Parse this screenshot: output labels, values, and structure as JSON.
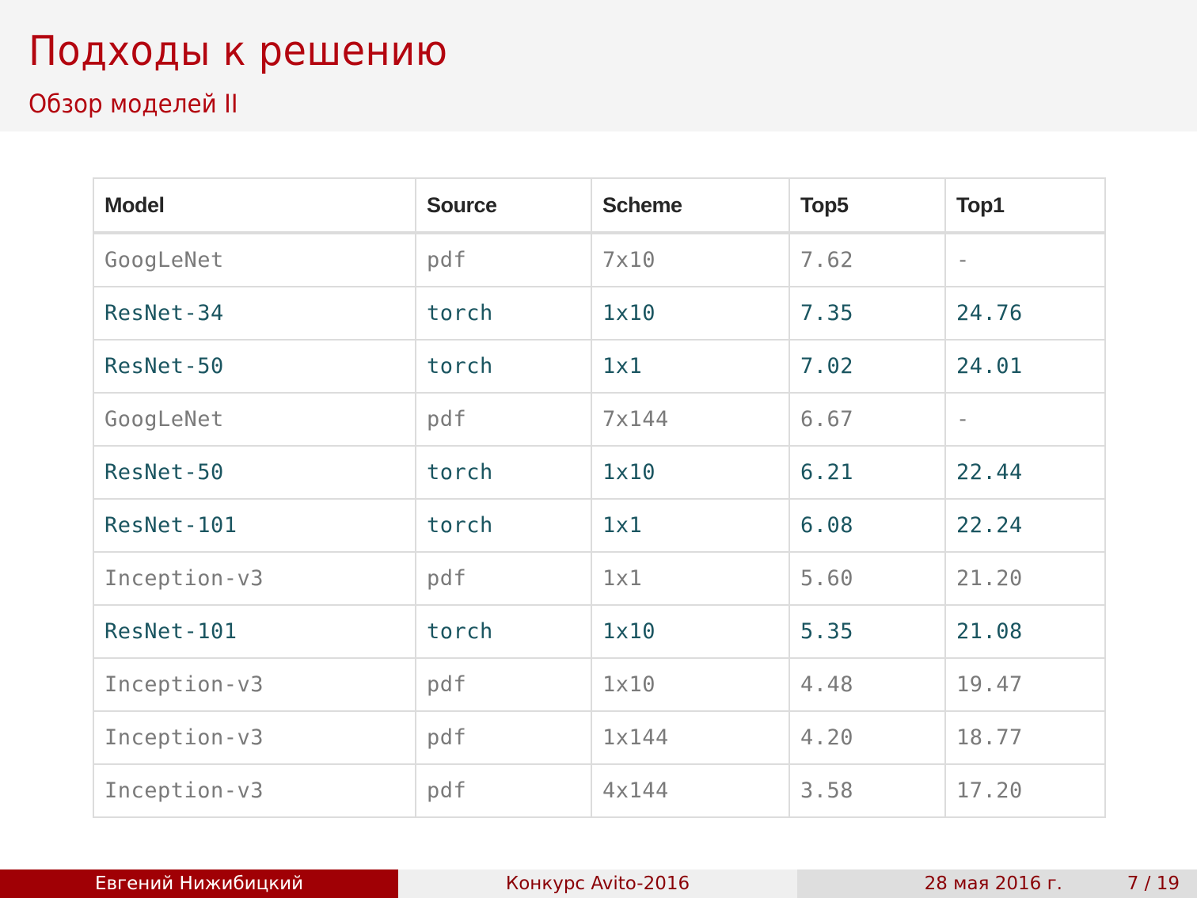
{
  "slide": {
    "title": "Подходы к решению",
    "subtitle": "Обзор моделей II"
  },
  "colors": {
    "accent_red": "#b3050f",
    "footer_author_bg": "#a00005",
    "torch_row_text": "#1a5560",
    "pdf_row_text": "#7a7a7a",
    "border": "#dcdcdc"
  },
  "table": {
    "headers": [
      "Model",
      "Source",
      "Scheme",
      "Top5",
      "Top1"
    ],
    "rows": [
      {
        "type": "pdf",
        "cells": [
          "GoogLeNet",
          "pdf",
          "7x10",
          "7.62",
          "-"
        ]
      },
      {
        "type": "torch",
        "cells": [
          "ResNet-34",
          "torch",
          "1x10",
          "7.35",
          "24.76"
        ]
      },
      {
        "type": "torch",
        "cells": [
          "ResNet-50",
          "torch",
          "1x1",
          "7.02",
          "24.01"
        ]
      },
      {
        "type": "pdf",
        "cells": [
          "GoogLeNet",
          "pdf",
          "7x144",
          "6.67",
          "-"
        ]
      },
      {
        "type": "torch",
        "cells": [
          "ResNet-50",
          "torch",
          "1x10",
          "6.21",
          "22.44"
        ]
      },
      {
        "type": "torch",
        "cells": [
          "ResNet-101",
          "torch",
          "1x1",
          "6.08",
          "22.24"
        ]
      },
      {
        "type": "pdf",
        "cells": [
          "Inception-v3",
          "pdf",
          "1x1",
          "5.60",
          "21.20"
        ]
      },
      {
        "type": "torch",
        "cells": [
          "ResNet-101",
          "torch",
          "1x10",
          "5.35",
          "21.08"
        ]
      },
      {
        "type": "pdf",
        "cells": [
          "Inception-v3",
          "pdf",
          "1x10",
          "4.48",
          "19.47"
        ]
      },
      {
        "type": "pdf",
        "cells": [
          "Inception-v3",
          "pdf",
          "1x144",
          "4.20",
          "18.77"
        ]
      },
      {
        "type": "pdf",
        "cells": [
          "Inception-v3",
          "pdf",
          "4x144",
          "3.58",
          "17.20"
        ]
      }
    ]
  },
  "footer": {
    "author": "Евгений Нижибицкий",
    "event": "Конкурс Avito-2016",
    "date": "28 мая 2016 г.",
    "page": "7 / 19"
  }
}
